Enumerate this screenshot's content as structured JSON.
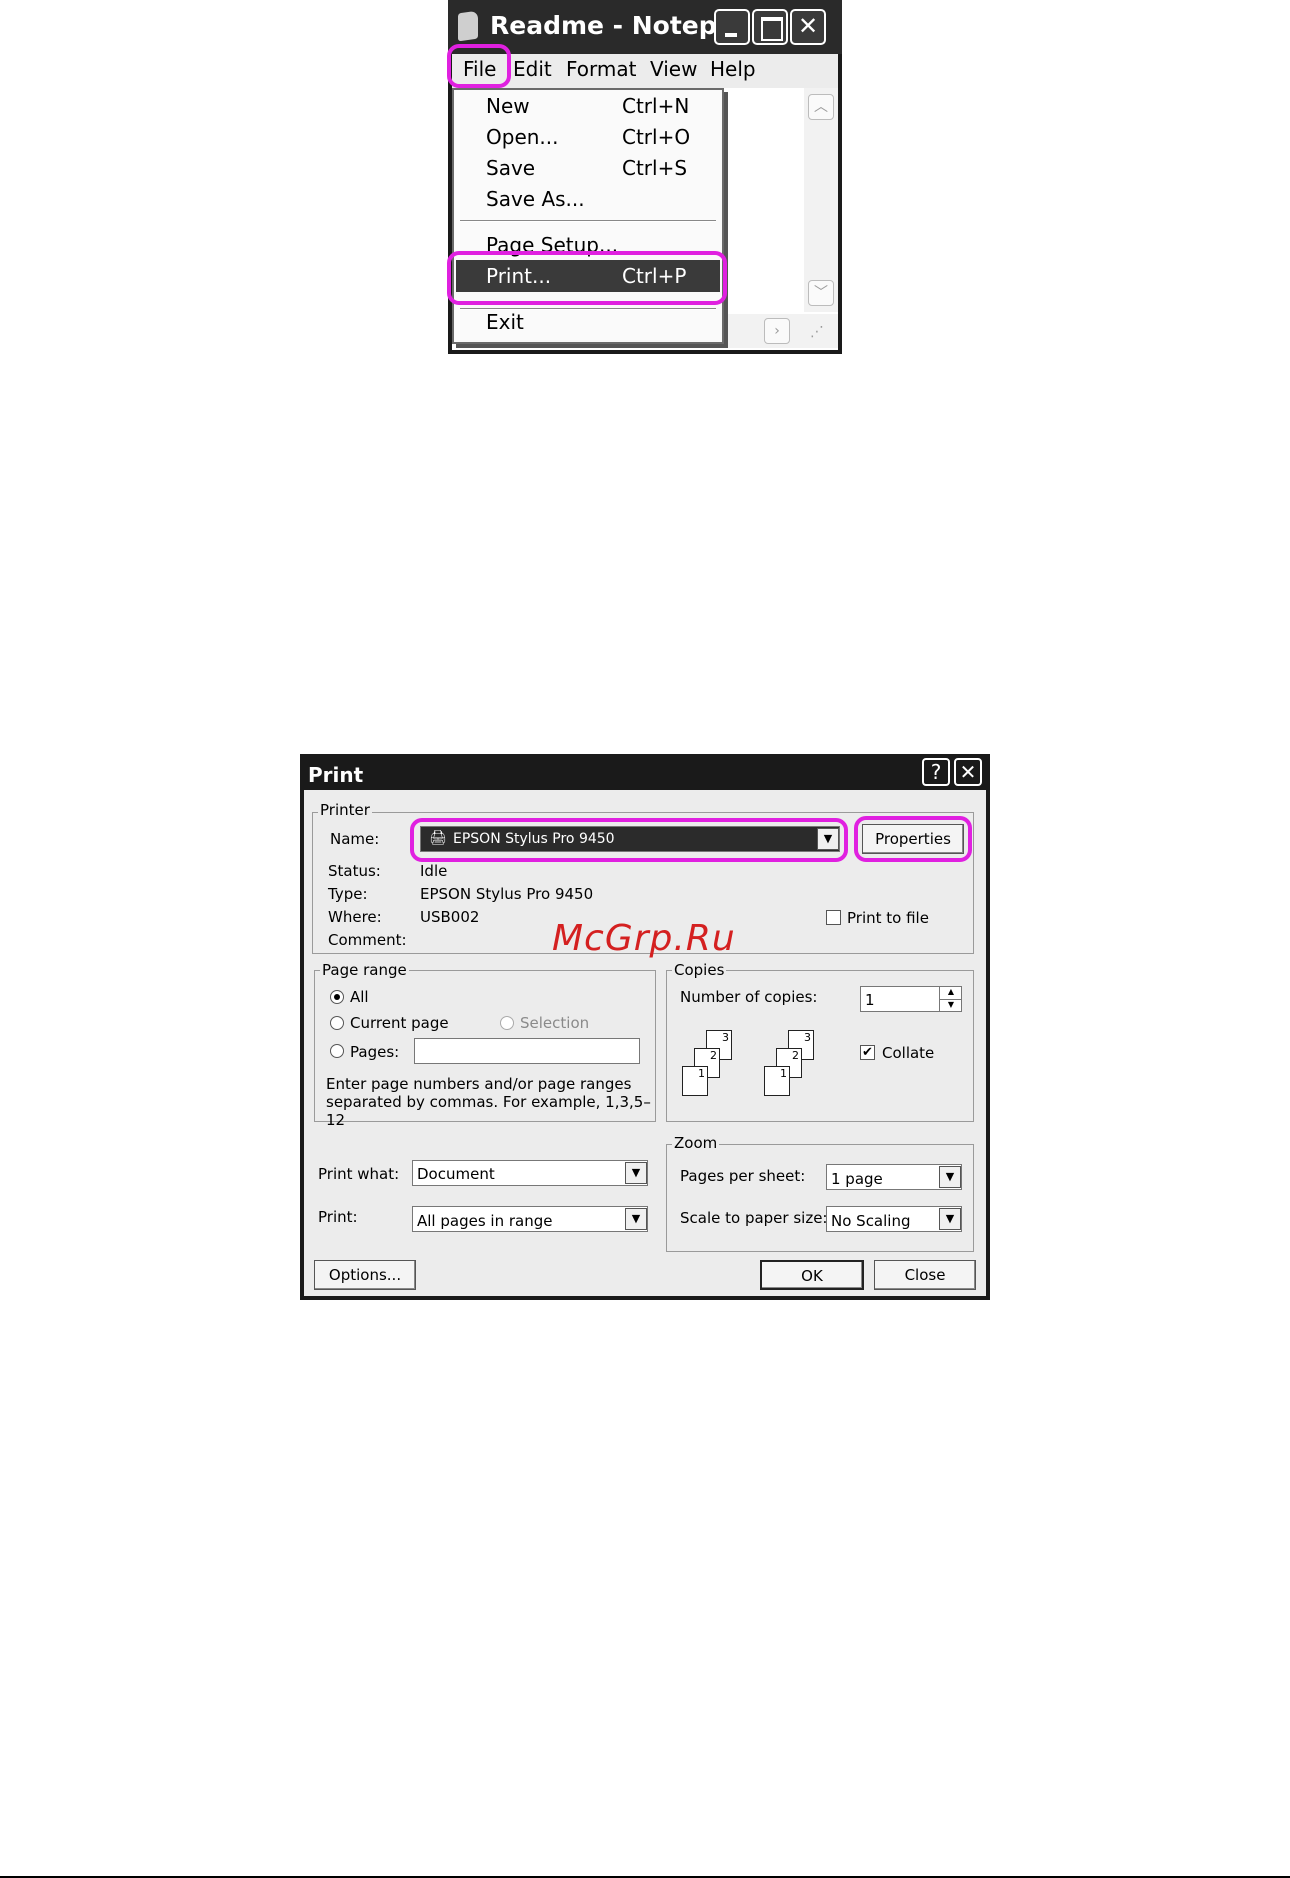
{
  "notepad": {
    "title": "Readme - Notepad",
    "menu": [
      "File",
      "Edit",
      "Format",
      "View",
      "Help"
    ],
    "file_menu": {
      "items": [
        {
          "label": "New",
          "shortcut": "Ctrl+N"
        },
        {
          "label": "Open...",
          "shortcut": "Ctrl+O"
        },
        {
          "label": "Save",
          "shortcut": "Ctrl+S"
        },
        {
          "label": "Save As...",
          "shortcut": ""
        },
        {
          "label": "Page Setup...",
          "shortcut": ""
        },
        {
          "label": "Print...",
          "shortcut": "Ctrl+P"
        },
        {
          "label": "Exit",
          "shortcut": ""
        }
      ]
    }
  },
  "print_dialog": {
    "title": "Print",
    "help_glyph": "?",
    "close_glyph": "✕",
    "printer": {
      "legend": "Printer",
      "name_label": "Name:",
      "name_value": "EPSON Stylus Pro 9450",
      "properties_label": "Properties",
      "status_label": "Status:",
      "status_value": "Idle",
      "type_label": "Type:",
      "type_value": "EPSON Stylus Pro 9450",
      "where_label": "Where:",
      "where_value": "USB002",
      "comment_label": "Comment:",
      "print_to_file_label": "Print to file"
    },
    "watermark": "McGrp.Ru",
    "page_range": {
      "legend": "Page range",
      "all": "All",
      "current_page": "Current page",
      "selection": "Selection",
      "pages": "Pages:",
      "hint": "Enter page numbers and/or page ranges separated by commas.  For example, 1,3,5–12"
    },
    "copies": {
      "legend": "Copies",
      "number_label": "Number of copies:",
      "number_value": "1",
      "collate_label": "Collate",
      "page_labels": [
        "3",
        "2",
        "1"
      ]
    },
    "print_what_label": "Print what:",
    "print_what_value": "Document",
    "print_label": "Print:",
    "print_value": "All pages in range",
    "zoom": {
      "legend": "Zoom",
      "pages_per_sheet_label": "Pages per sheet:",
      "pages_per_sheet_value": "1 page",
      "scale_label": "Scale to paper size:",
      "scale_value": "No Scaling"
    },
    "buttons": {
      "options": "Options...",
      "ok": "OK",
      "close": "Close"
    },
    "colors": {
      "highlight": "#e020e0",
      "title_bar": "#1a1a1a",
      "dialog_face": "#ececec"
    }
  }
}
